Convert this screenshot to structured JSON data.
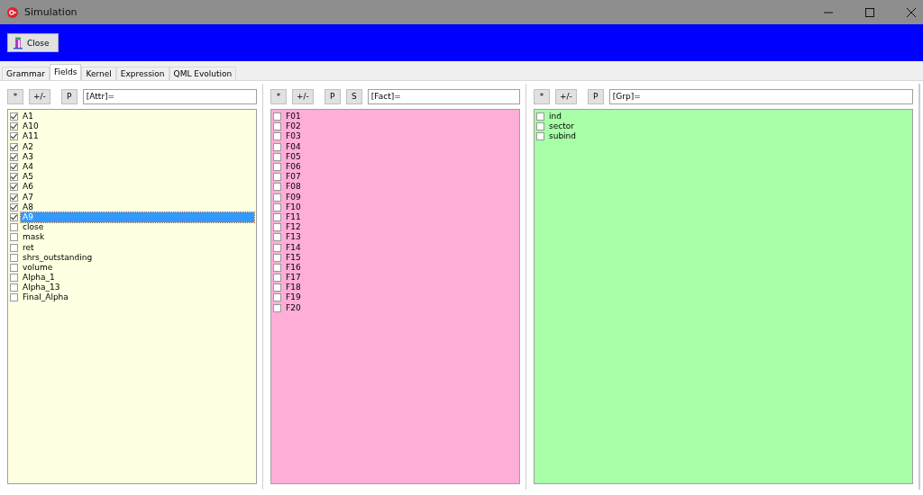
{
  "window": {
    "title": "Simulation"
  },
  "toolbar": {
    "buttons": [
      "Close"
    ]
  },
  "tabs": [
    {
      "label": "Grammar",
      "selected": false
    },
    {
      "label": "Fields",
      "selected": true
    },
    {
      "label": "Kernel",
      "selected": false
    },
    {
      "label": "Expression",
      "selected": false
    },
    {
      "label": "QML Evolution",
      "selected": false
    }
  ],
  "panels": [
    {
      "buttons": [
        "*",
        "+/-",
        "P"
      ],
      "field": {
        "value": "[Attr]="
      },
      "color": "#ffffe1",
      "items": [
        {
          "label": "A1",
          "checked": true,
          "selected": false
        },
        {
          "label": "A10",
          "checked": true,
          "selected": false
        },
        {
          "label": "A11",
          "checked": true,
          "selected": false
        },
        {
          "label": "A2",
          "checked": true,
          "selected": false
        },
        {
          "label": "A3",
          "checked": true,
          "selected": false
        },
        {
          "label": "A4",
          "checked": true,
          "selected": false
        },
        {
          "label": "A5",
          "checked": true,
          "selected": false
        },
        {
          "label": "A6",
          "checked": true,
          "selected": false
        },
        {
          "label": "A7",
          "checked": true,
          "selected": false
        },
        {
          "label": "A8",
          "checked": true,
          "selected": false
        },
        {
          "label": "A9",
          "checked": true,
          "selected": true
        },
        {
          "label": "close",
          "checked": false,
          "selected": false
        },
        {
          "label": "mask",
          "checked": false,
          "selected": false
        },
        {
          "label": "ret",
          "checked": false,
          "selected": false
        },
        {
          "label": "shrs_outstanding",
          "checked": false,
          "selected": false
        },
        {
          "label": "volume",
          "checked": false,
          "selected": false
        },
        {
          "label": "Alpha_1",
          "checked": false,
          "selected": false
        },
        {
          "label": "Alpha_13",
          "checked": false,
          "selected": false
        },
        {
          "label": "Final_Alpha",
          "checked": false,
          "selected": false
        }
      ]
    },
    {
      "buttons": [
        "*",
        "+/-",
        "P",
        "S"
      ],
      "field": {
        "value": "[Fact]="
      },
      "color": "#ffaed7",
      "items": [
        {
          "label": "F01",
          "checked": false,
          "selected": false
        },
        {
          "label": "F02",
          "checked": false,
          "selected": false
        },
        {
          "label": "F03",
          "checked": false,
          "selected": false
        },
        {
          "label": "F04",
          "checked": false,
          "selected": false
        },
        {
          "label": "F05",
          "checked": false,
          "selected": false
        },
        {
          "label": "F06",
          "checked": false,
          "selected": false
        },
        {
          "label": "F07",
          "checked": false,
          "selected": false
        },
        {
          "label": "F08",
          "checked": false,
          "selected": false
        },
        {
          "label": "F09",
          "checked": false,
          "selected": false
        },
        {
          "label": "F10",
          "checked": false,
          "selected": false
        },
        {
          "label": "F11",
          "checked": false,
          "selected": false
        },
        {
          "label": "F12",
          "checked": false,
          "selected": false
        },
        {
          "label": "F13",
          "checked": false,
          "selected": false
        },
        {
          "label": "F14",
          "checked": false,
          "selected": false
        },
        {
          "label": "F15",
          "checked": false,
          "selected": false
        },
        {
          "label": "F16",
          "checked": false,
          "selected": false
        },
        {
          "label": "F17",
          "checked": false,
          "selected": false
        },
        {
          "label": "F18",
          "checked": false,
          "selected": false
        },
        {
          "label": "F19",
          "checked": false,
          "selected": false
        },
        {
          "label": "F20",
          "checked": false,
          "selected": false
        }
      ]
    },
    {
      "buttons": [
        "*",
        "+/-",
        "P"
      ],
      "field": {
        "value": "[Grp]="
      },
      "color": "#a8ffa8",
      "items": [
        {
          "label": "ind",
          "checked": false,
          "selected": false
        },
        {
          "label": "sector",
          "checked": false,
          "selected": false
        },
        {
          "label": "subind",
          "checked": false,
          "selected": false
        }
      ]
    }
  ]
}
